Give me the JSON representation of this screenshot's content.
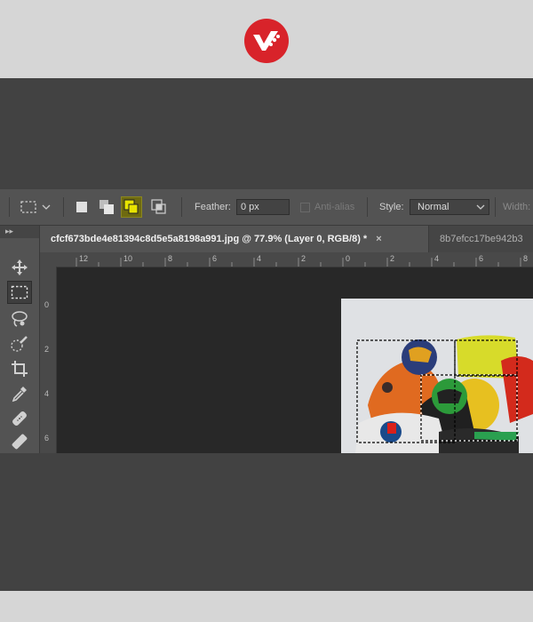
{
  "logo": {
    "icon": "brand-logo-icon",
    "color": "#d8232a"
  },
  "options_bar": {
    "feather_label": "Feather:",
    "feather_value": "0 px",
    "antialias_label": "Anti-alias",
    "style_label": "Style:",
    "style_value": "Normal",
    "width_label": "Width:"
  },
  "toolbar_header": "▸▸",
  "tabs": [
    {
      "label": "cfcf673bde4e81394c8d5e5a8198a991.jpg @ 77.9% (Layer 0, RGB/8) *",
      "close": "×",
      "active": true
    },
    {
      "label": "8b7efcc17be942b3",
      "active": false
    }
  ],
  "ruler": {
    "horizontal": [
      "12",
      "10",
      "8",
      "6",
      "4",
      "2",
      "0",
      "2",
      "4",
      "6",
      "8"
    ],
    "vertical": [
      "0",
      "2",
      "4",
      "6"
    ]
  },
  "colors": {
    "accent_active": "#6e6a10",
    "ui_dark": "#535353",
    "canvas": "#282828"
  }
}
